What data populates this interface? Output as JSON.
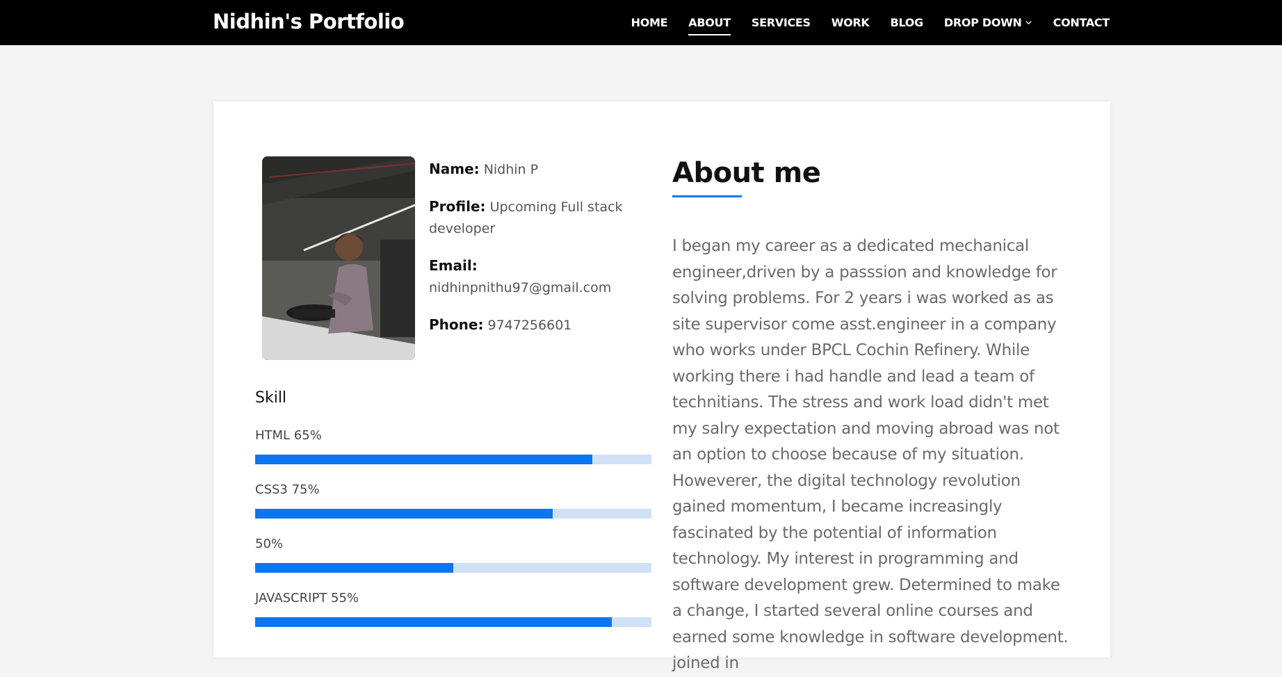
{
  "header": {
    "brand": "Nidhin's Portfolio",
    "nav": [
      {
        "label": "HOME"
      },
      {
        "label": "ABOUT",
        "active": true
      },
      {
        "label": "SERVICES"
      },
      {
        "label": "WORK"
      },
      {
        "label": "BLOG"
      },
      {
        "label": "DROP DOWN"
      },
      {
        "label": "CONTACT"
      }
    ]
  },
  "profile": {
    "name_label": "Name:",
    "name": "Nidhin P",
    "profile_label": "Profile:",
    "profile": "Upcoming Full stack developer",
    "email_label": "Email:",
    "email": "nidhinpnithu97@gmail.com",
    "phone_label": "Phone:",
    "phone": "9747256601"
  },
  "skills": {
    "title": "Skill",
    "items": [
      {
        "label": "HTML 65%",
        "level": 0.85
      },
      {
        "label": "CSS3 75%",
        "level": 0.75
      },
      {
        "label": "50%",
        "level": 0.5
      },
      {
        "label": "JAVASCRIPT 55%",
        "level": 0.9
      }
    ]
  },
  "about": {
    "title": "About me",
    "text": "I began my career as a dedicated mechanical engineer,driven by a passsion and knowledge for solving problems. For 2 years i was worked as as site supervisor come asst.engineer in a company who works under BPCL Cochin Refinery. While working there i had handle and lead a team of technitians. The stress and work load didn't met my salry expectation and moving abroad was not an option to choose because of my situation. Howeverer, the digital technology revolution gained momentum, I became increasingly fascinated by the potential of information technology. My interest in programming and software development grew. Determined to make a change, I started several online courses and earned some knowledge in software development. joined in"
  },
  "colors": {
    "accent": "#0d75f1",
    "bar_track": "#cfe0f7",
    "navbar": "#000000"
  }
}
